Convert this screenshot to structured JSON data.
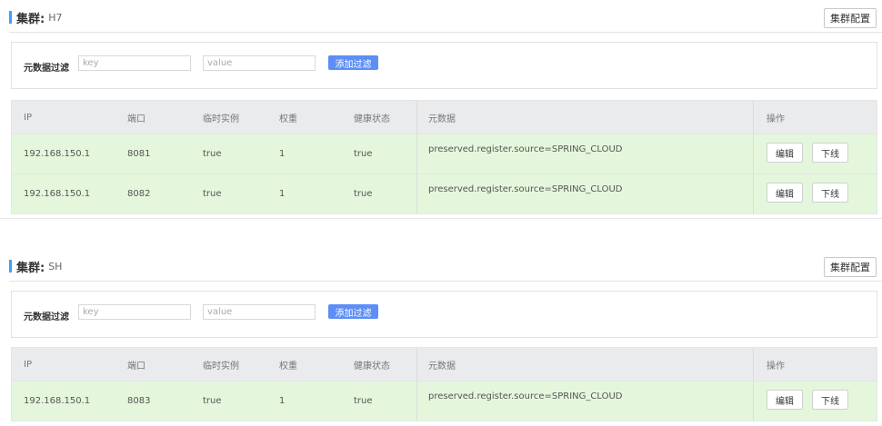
{
  "labels": {
    "cluster_prefix": "集群:",
    "config_button": "集群配置",
    "filter_label": "元数据过滤",
    "key_placeholder": "key",
    "value_placeholder": "value",
    "add_filter": "添加过滤",
    "edit": "编辑",
    "offline": "下线"
  },
  "columns": [
    "IP",
    "端口",
    "临时实例",
    "权重",
    "健康状态",
    "元数据",
    "操作"
  ],
  "clusters": [
    {
      "name": "H7",
      "rows": [
        {
          "ip": "192.168.150.1",
          "port": "8081",
          "ephemeral": "true",
          "weight": "1",
          "healthy": "true",
          "metadata": "preserved.register.source=SPRING_CLOUD"
        },
        {
          "ip": "192.168.150.1",
          "port": "8082",
          "ephemeral": "true",
          "weight": "1",
          "healthy": "true",
          "metadata": "preserved.register.source=SPRING_CLOUD"
        }
      ]
    },
    {
      "name": "SH",
      "rows": [
        {
          "ip": "192.168.150.1",
          "port": "8083",
          "ephemeral": "true",
          "weight": "1",
          "healthy": "true",
          "metadata": "preserved.register.source=SPRING_CLOUD"
        }
      ]
    }
  ],
  "colors": {
    "accent": "#409eff",
    "button": "#5c8ef6",
    "row_bg": "#e4f7dc",
    "header_bg": "#eaebec"
  }
}
